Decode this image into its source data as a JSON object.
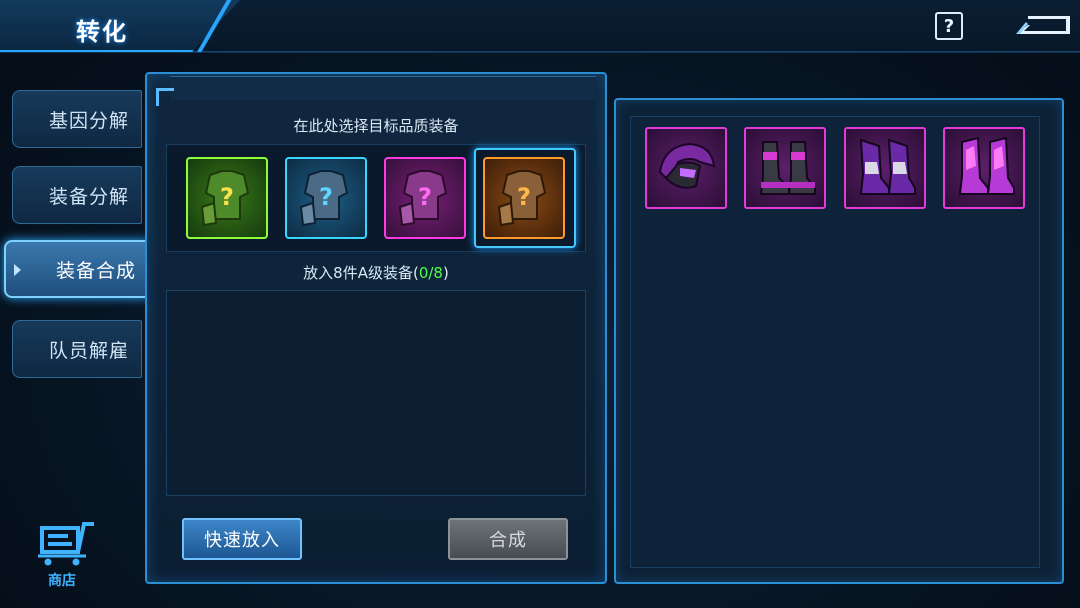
{
  "header": {
    "title": "转化",
    "help_icon": "question-icon",
    "back_icon": "return-arrow-icon"
  },
  "sidebar": {
    "items": [
      {
        "label": "基因分解",
        "active": false
      },
      {
        "label": "装备分解",
        "active": false
      },
      {
        "label": "装备合成",
        "active": true
      },
      {
        "label": "队员解雇",
        "active": false
      }
    ],
    "shop_label": "商店"
  },
  "left_panel": {
    "select_hint": "在此处选择目标品质装备",
    "quality_slots": [
      {
        "quality": "green",
        "icon": "mystery-armor-icon"
      },
      {
        "quality": "blue",
        "icon": "mystery-armor-icon"
      },
      {
        "quality": "purple",
        "icon": "mystery-armor-icon"
      },
      {
        "quality": "orange",
        "icon": "mystery-armor-icon",
        "selected": true
      }
    ],
    "put_hint_prefix": "放入8件A级装备(",
    "put_count": "0/8",
    "put_hint_suffix": ")",
    "quick_put_label": "快速放入",
    "synth_label": "合成"
  },
  "right_panel": {
    "items": [
      {
        "icon": "purple-helmet-icon"
      },
      {
        "icon": "purple-boots-icon"
      },
      {
        "icon": "purple-boots-icon"
      },
      {
        "icon": "purple-boots-icon"
      }
    ]
  },
  "colors": {
    "accent": "#2aa7ff",
    "green_quality": "#8dff3a",
    "blue_quality": "#38d6ff",
    "purple_quality": "#ff3ae0",
    "orange_quality": "#ff9a2a",
    "count_text": "#4dff4d"
  }
}
